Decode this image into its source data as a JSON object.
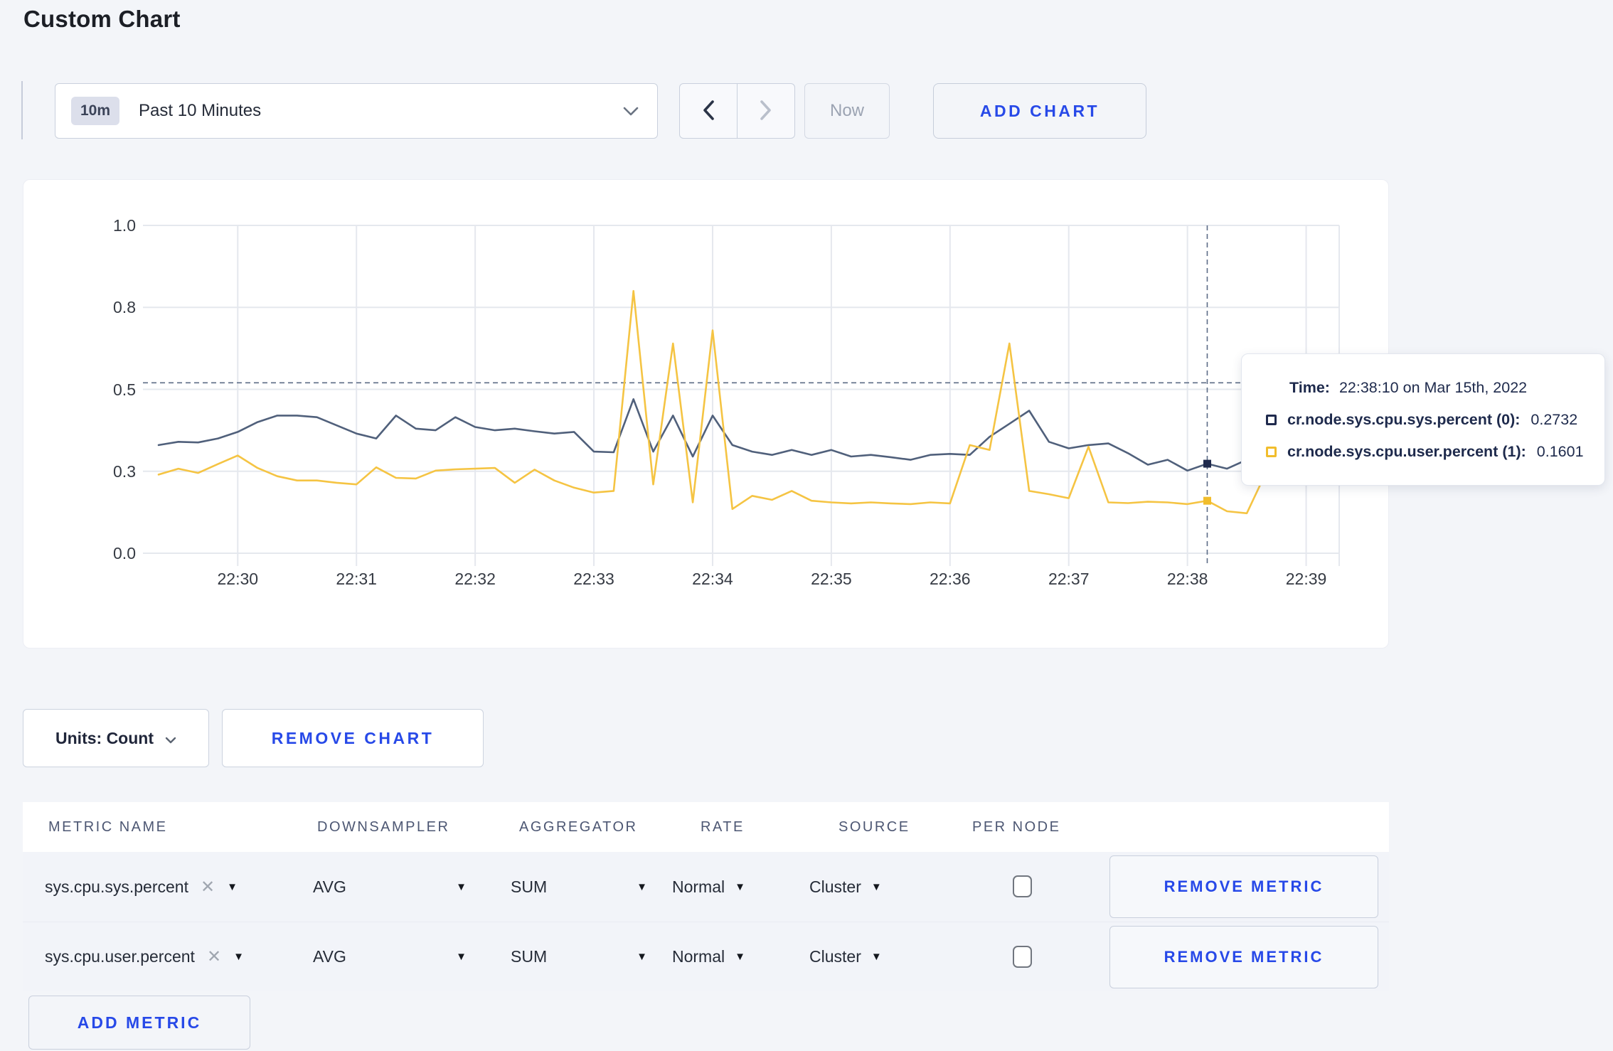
{
  "page_title": "Custom Chart",
  "toolbar": {
    "time_badge": "10m",
    "time_label": "Past 10 Minutes",
    "now_label": "Now",
    "add_chart_label": "ADD CHART"
  },
  "chart_actions": {
    "units_label": "Units: Count",
    "remove_chart_label": "REMOVE CHART"
  },
  "tooltip": {
    "time_label": "Time:",
    "time_value": "22:38:10 on Mar 15th, 2022",
    "series": [
      {
        "name": "cr.node.sys.cpu.sys.percent (0):",
        "value": "0.2732",
        "color": "#1f2a4d"
      },
      {
        "name": "cr.node.sys.cpu.user.percent (1):",
        "value": "0.1601",
        "color": "#f1bd2c"
      }
    ]
  },
  "chart_data": {
    "type": "line",
    "title": "",
    "xlabel": "",
    "ylabel": "",
    "ylim": [
      0,
      1
    ],
    "grid": true,
    "legend_position": "tooltip",
    "x_ticks": [
      "22:30",
      "22:31",
      "22:32",
      "22:33",
      "22:34",
      "22:35",
      "22:36",
      "22:37",
      "22:38",
      "22:39"
    ],
    "y_ticks": [
      {
        "label": "1.0",
        "value": 1.0
      },
      {
        "label": "0.8",
        "value": 0.75
      },
      {
        "label": "0.5",
        "value": 0.5
      },
      {
        "label": "0.3",
        "value": 0.25
      },
      {
        "label": "0.0",
        "value": 0.0
      }
    ],
    "x_start_time": "22:29:20",
    "x_step_seconds": 10,
    "series": [
      {
        "name": "cr.node.sys.cpu.sys.percent",
        "color": "#50607b",
        "values": [
          0.33,
          0.34,
          0.338,
          0.35,
          0.37,
          0.4,
          0.42,
          0.42,
          0.415,
          0.39,
          0.365,
          0.35,
          0.42,
          0.38,
          0.375,
          0.415,
          0.385,
          0.375,
          0.38,
          0.372,
          0.365,
          0.37,
          0.31,
          0.308,
          0.47,
          0.31,
          0.42,
          0.295,
          0.42,
          0.33,
          0.31,
          0.3,
          0.315,
          0.3,
          0.315,
          0.295,
          0.3,
          0.293,
          0.285,
          0.3,
          0.303,
          0.3,
          0.355,
          0.395,
          0.435,
          0.34,
          0.32,
          0.33,
          0.335,
          0.305,
          0.27,
          0.285,
          0.252,
          0.2732,
          0.258,
          0.285,
          0.32,
          0.3,
          0.292,
          0.308
        ]
      },
      {
        "name": "cr.node.sys.cpu.user.percent",
        "color": "#f5c443",
        "values": [
          0.24,
          0.258,
          0.245,
          0.272,
          0.298,
          0.26,
          0.235,
          0.222,
          0.222,
          0.215,
          0.21,
          0.262,
          0.23,
          0.228,
          0.252,
          0.256,
          0.258,
          0.26,
          0.215,
          0.255,
          0.222,
          0.2,
          0.185,
          0.19,
          0.8,
          0.21,
          0.64,
          0.155,
          0.68,
          0.135,
          0.175,
          0.163,
          0.19,
          0.16,
          0.155,
          0.152,
          0.155,
          0.152,
          0.15,
          0.155,
          0.152,
          0.33,
          0.315,
          0.64,
          0.19,
          0.18,
          0.168,
          0.325,
          0.155,
          0.153,
          0.157,
          0.155,
          0.15,
          0.1601,
          0.128,
          0.122,
          0.25,
          0.29,
          0.235,
          0.272
        ]
      }
    ],
    "crosshair": {
      "time": "22:38:10",
      "index": 53,
      "hline_value": 0.52,
      "points": [
        0.2732,
        0.1601
      ]
    }
  },
  "metrics_table": {
    "headers": [
      "METRIC NAME",
      "DOWNSAMPLER",
      "AGGREGATOR",
      "RATE",
      "SOURCE",
      "PER NODE"
    ],
    "rows": [
      {
        "metric": "sys.cpu.sys.percent",
        "remove": "✕",
        "downsampler": "AVG",
        "aggregator": "SUM",
        "rate": "Normal",
        "source": "Cluster",
        "per_node_checked": false,
        "action_label": "REMOVE METRIC"
      },
      {
        "metric": "sys.cpu.user.percent",
        "remove": "✕",
        "downsampler": "AVG",
        "aggregator": "SUM",
        "rate": "Normal",
        "source": "Cluster",
        "per_node_checked": false,
        "action_label": "REMOVE METRIC"
      }
    ],
    "add_metric_label": "ADD METRIC"
  }
}
